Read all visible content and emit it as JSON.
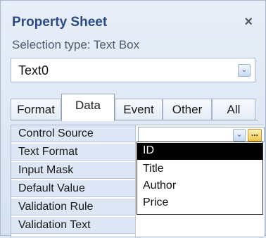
{
  "panel": {
    "title": "Property Sheet",
    "close_glyph": "×",
    "selection_type": "Selection type:  Text Box"
  },
  "object_selector": {
    "value": "Text0",
    "icon": "chevron-down-icon"
  },
  "tabs": [
    {
      "label": "Format",
      "active": false
    },
    {
      "label": "Data",
      "active": true
    },
    {
      "label": "Event",
      "active": false
    },
    {
      "label": "Other",
      "active": false
    },
    {
      "label": "All",
      "active": false
    }
  ],
  "properties": [
    {
      "label": "Control Source",
      "value": ""
    },
    {
      "label": "Text Format",
      "value": ""
    },
    {
      "label": "Input Mask",
      "value": ""
    },
    {
      "label": "Default Value",
      "value": ""
    },
    {
      "label": "Validation Rule",
      "value": ""
    },
    {
      "label": "Validation Text",
      "value": ""
    }
  ],
  "control_source": {
    "dropdown_icon": "chevron-down-icon",
    "builder_icon": "ellipsis-builder-icon",
    "builder_glyph": "..."
  },
  "dropdown_options": [
    {
      "label": "ID",
      "selected": true
    },
    {
      "label": "Title",
      "selected": false
    },
    {
      "label": "Author",
      "selected": false
    },
    {
      "label": "Price",
      "selected": false
    }
  ],
  "colors": {
    "title": "#2b4b85",
    "selected_option_bg": "#000000",
    "grid_label_bg": "#dce6f4"
  }
}
